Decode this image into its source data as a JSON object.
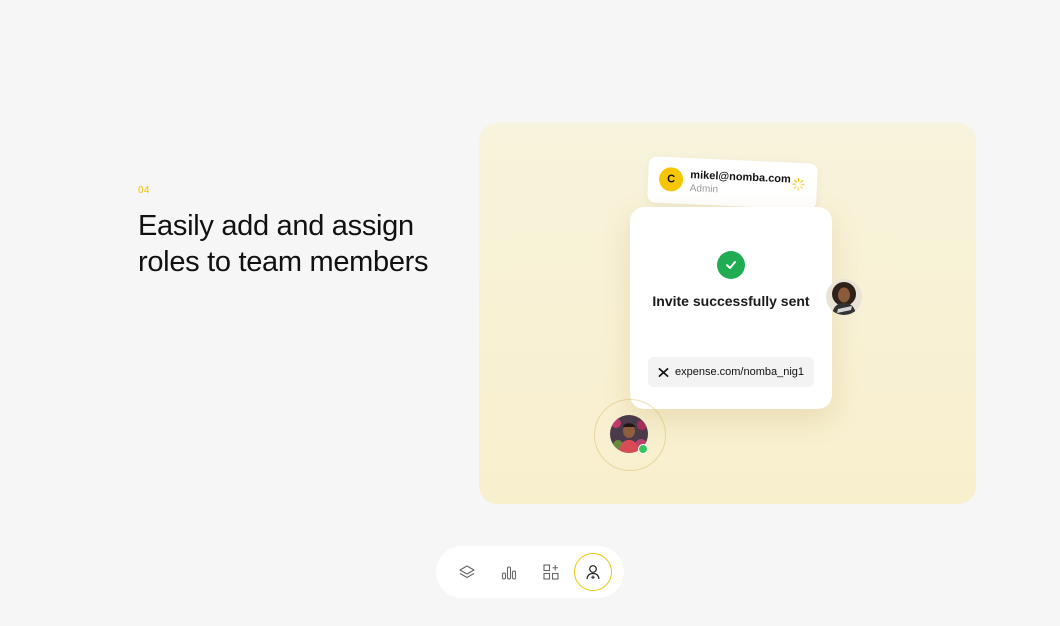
{
  "section": {
    "step_number": "04",
    "headline": "Easily add and assign roles to team members"
  },
  "email_card": {
    "initial": "C",
    "email": "mikel@nomba.com",
    "role": "Admin",
    "status_icon": "loading-spinner-icon"
  },
  "invite_card": {
    "status_icon": "check-circle-icon",
    "title": "Invite successfully sent",
    "link_icon": "nomba-x-logo-icon",
    "link": "expense.com/nomba_nig1"
  },
  "avatars": {
    "online_status_color": "#35c45a"
  },
  "tabs": [
    {
      "icon": "layers-icon",
      "active": false
    },
    {
      "icon": "bar-chart-icon",
      "active": false
    },
    {
      "icon": "apps-add-icon",
      "active": false
    },
    {
      "icon": "add-user-icon",
      "active": true
    }
  ],
  "colors": {
    "accent": "#f7c600",
    "success": "#1fac53",
    "panel_bg": "#f8f1d4"
  }
}
